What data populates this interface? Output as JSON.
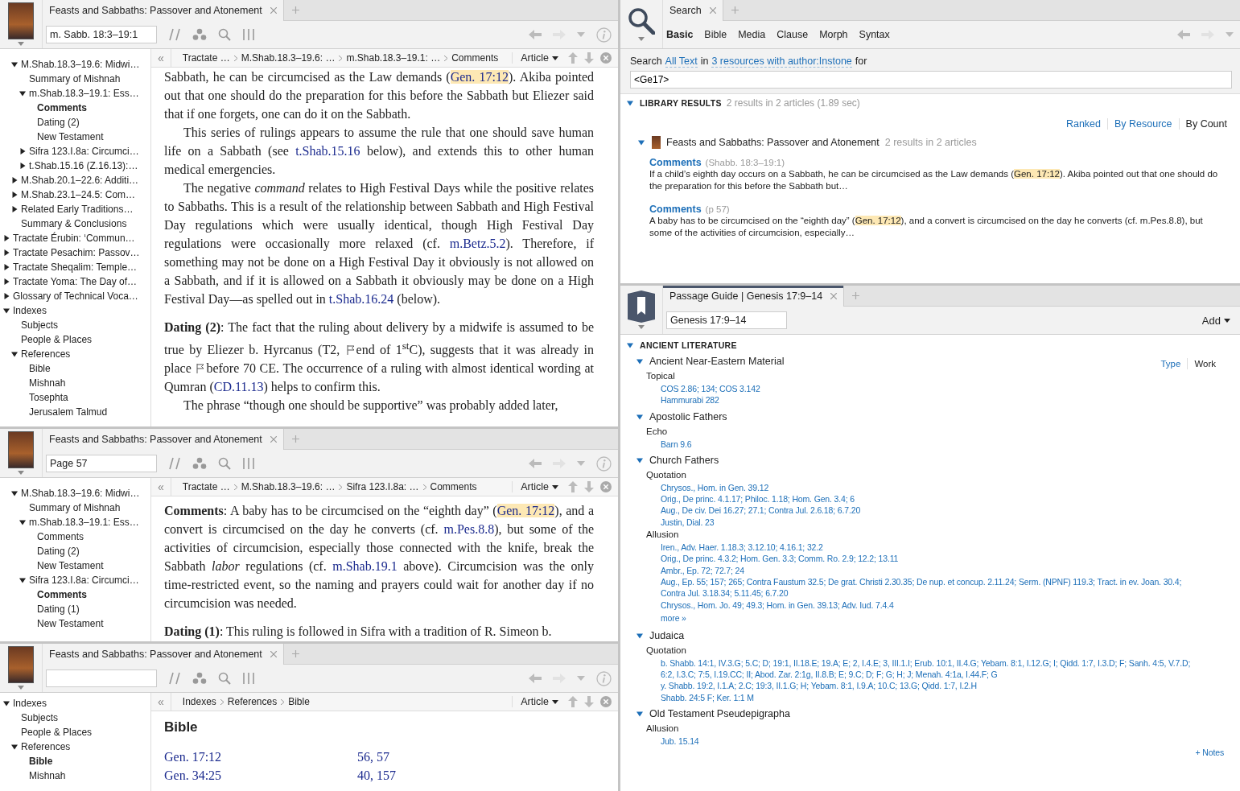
{
  "book_panels": [
    {
      "tab_title": "Feasts and Sabbaths: Passover and Atonement",
      "reference": "m. Sabb. 18:3–19:1",
      "collapse_glyph": "«",
      "view_menu": "Article",
      "tree": [
        {
          "children": [
            {
              "label": "M.Shab.18.3–19.6: Midwi…",
              "selected": false,
              "expanded": true,
              "children": [
                {
                  "label": "Summary of Mishnah",
                  "selected": false
                },
                {
                  "label": "m.Shab.18.3–19.1: Ess…",
                  "selected": false,
                  "expanded": true,
                  "children": [
                    {
                      "label": "Comments",
                      "selected": true
                    },
                    {
                      "label": "Dating (2)",
                      "selected": false
                    },
                    {
                      "label": "New Testament",
                      "selected": false
                    }
                  ]
                },
                {
                  "label": "Sifra 123.I.8a: Circumci…",
                  "selected": false,
                  "expanded": false
                },
                {
                  "label": "t.Shab.15.16 (Z.16.13):…",
                  "selected": false,
                  "expanded": false
                }
              ]
            },
            {
              "label": "M.Shab.20.1–22.6: Additi…",
              "selected": false,
              "expanded": false
            },
            {
              "label": "M.Shab.23.1–24.5: Com…",
              "selected": false,
              "expanded": false
            },
            {
              "label": "Related Early Traditions…",
              "selected": false,
              "expanded": false
            },
            {
              "label": "Summary & Conclusions",
              "selected": false
            }
          ]
        },
        {
          "label": "Tractate Érubin: ‘Commun…",
          "selected": false,
          "expanded": false
        },
        {
          "label": "Tractate Pesachim: Passov…",
          "selected": false,
          "expanded": false
        },
        {
          "label": "Tractate Sheqalim: Temple…",
          "selected": false,
          "expanded": false
        },
        {
          "label": "Tractate Yoma: The Day of…",
          "selected": false,
          "expanded": false
        },
        {
          "label": "Glossary of Technical Voca…",
          "selected": false,
          "expanded": false
        },
        {
          "label": "Indexes",
          "selected": false,
          "expanded": true,
          "children": [
            {
              "label": "Subjects",
              "selected": false
            },
            {
              "label": "People & Places",
              "selected": false
            },
            {
              "label": "References",
              "selected": false,
              "expanded": true,
              "children": [
                {
                  "label": "Bible",
                  "selected": false
                },
                {
                  "label": "Mishnah",
                  "selected": false
                },
                {
                  "label": "Tosephta",
                  "selected": false
                },
                {
                  "label": "Jerusalem Talmud",
                  "selected": false
                }
              ]
            }
          ]
        }
      ],
      "breadcrumbs": [
        "Tractate …",
        "M.Shab.18.3–19.6: …",
        "m.Shab.18.3–19.1: …",
        "Comments"
      ],
      "content": [
        {
          "kind": "continuation",
          "runs": [
            {
              "kind": "text",
              "text": "Sabbath, he can be circumcised as the Law demands ("
            },
            {
              "kind": "link",
              "text": "Gen. 17:12",
              "highlighted": true
            },
            {
              "kind": "text",
              "text": "). Akiba pointed out that one should do the preparation for this before the Sabbath but Eliezer said that if one forgets, one can do it on the Sabbath."
            }
          ]
        },
        {
          "kind": "indented",
          "runs": [
            {
              "kind": "text",
              "text": "This series of rulings appears to assume the rule that one should save human life on a Sabbath (see "
            },
            {
              "kind": "link",
              "text": "t.Shab.15.16",
              "highlighted": false
            },
            {
              "kind": "text",
              "text": " below), and extends this to other human medical emergencies."
            }
          ]
        },
        {
          "kind": "indented",
          "runs": [
            {
              "kind": "text",
              "text": "The negative *command* relates to High Festival Days while the positive relates to Sabbaths. This is a result of the relationship between Sabbath and High Festival Day regulations which were usually identical, though High Festival Day regulations were occasionally more relaxed (cf. "
            },
            {
              "kind": "link",
              "text": "m.Betz.5.2",
              "highlighted": false
            },
            {
              "kind": "text",
              "text": "). Therefore, if something may not be done on a High Festival Day it obviously is not allowed on a Sabbath, and if it is allowed on a Sabbath it obviously may be done on a High Festival Day—as spelled out in "
            },
            {
              "kind": "link",
              "text": "t.Shab.16.24",
              "highlighted": false
            },
            {
              "kind": "text",
              "text": " (below)."
            }
          ]
        },
        {
          "kind": "section",
          "runs": [
            {
              "kind": "text",
              "text": "**Dating (2)**: The fact that the ruling about delivery by a midwife is assumed to be true by Eliezer b. Hyrcanus (T2, "
            },
            {
              "kind": "flag"
            },
            {
              "kind": "text",
              "text": "end of 1$^{st}$C), suggests that it was already in place "
            },
            {
              "kind": "flag"
            },
            {
              "kind": "text",
              "text": "before 70 CE. The occurrence of a ruling with almost identical wording at Qumran ("
            },
            {
              "kind": "link",
              "text": "CD.11.13",
              "highlighted": false
            },
            {
              "kind": "text",
              "text": ") helps to confirm this."
            }
          ]
        },
        {
          "kind": "indented",
          "runs": [
            {
              "kind": "text",
              "text": "The phrase “though one should be supportive” was probably added later,"
            }
          ]
        }
      ]
    },
    {
      "tab_title": "Feasts and Sabbaths: Passover and Atonement",
      "reference": "Page 57",
      "collapse_glyph": "«",
      "view_menu": "Article",
      "tree": [
        {
          "children": [
            {
              "label": "M.Shab.18.3–19.6: Midwi…",
              "selected": false,
              "expanded": true,
              "children": [
                {
                  "label": "Summary of Mishnah",
                  "selected": false
                },
                {
                  "label": "m.Shab.18.3–19.1: Ess…",
                  "selected": false,
                  "expanded": true,
                  "children": [
                    {
                      "label": "Comments",
                      "selected": false
                    },
                    {
                      "label": "Dating (2)",
                      "selected": false
                    },
                    {
                      "label": "New Testament",
                      "selected": false
                    }
                  ]
                },
                {
                  "label": "Sifra 123.I.8a: Circumci…",
                  "selected": false,
                  "expanded": true,
                  "children": [
                    {
                      "label": "Comments",
                      "selected": true
                    },
                    {
                      "label": "Dating (1)",
                      "selected": false
                    },
                    {
                      "label": "New Testament",
                      "selected": false
                    }
                  ]
                }
              ]
            }
          ]
        }
      ],
      "breadcrumbs": [
        "Tractate …",
        "M.Shab.18.3–19.6: …",
        "Sifra 123.I.8a: …",
        "Comments"
      ],
      "content": [
        {
          "kind": "continuation",
          "runs": [
            {
              "kind": "text",
              "text": "**Comments**: A baby has to be circumcised on the “eighth day” ("
            },
            {
              "kind": "link",
              "text": "Gen. 17:12",
              "highlighted": true
            },
            {
              "kind": "text",
              "text": "), and a convert is circumcised on the day he converts (cf. "
            },
            {
              "kind": "link",
              "text": "m.Pes.8.8",
              "highlighted": false
            },
            {
              "kind": "text",
              "text": "), but some of the activities of circumcision, especially those connected with the knife, break the Sabbath *labor* regulations (cf. "
            },
            {
              "kind": "link",
              "text": "m.Shab.19.1",
              "highlighted": false
            },
            {
              "kind": "text",
              "text": " above). Circumcision was the only time-restricted event, so the naming and prayers could wait for another day if no circumcision was needed."
            }
          ]
        },
        {
          "kind": "section",
          "runs": [
            {
              "kind": "text",
              "text": "**Dating (1)**: This ruling is followed in Sifra with a tradition of R. Simeon b."
            }
          ]
        }
      ]
    },
    {
      "tab_title": "Feasts and Sabbaths: Passover and Atonement",
      "collapse_glyph": "«",
      "view_menu": "Article",
      "tree": [
        {
          "label": "Indexes",
          "selected": false,
          "expanded": true,
          "children": [
            {
              "label": "Subjects",
              "selected": false
            },
            {
              "label": "People & Places",
              "selected": false
            },
            {
              "label": "References",
              "selected": false,
              "expanded": true,
              "children": [
                {
                  "label": "Bible",
                  "selected": true
                },
                {
                  "label": "Mishnah",
                  "selected": false
                }
              ]
            }
          ]
        }
      ],
      "breadcrumbs": [
        "Indexes",
        "References",
        "Bible"
      ],
      "content": [
        {
          "kind": "heading",
          "text": "Bible"
        },
        {
          "kind": "index-row",
          "cells": [
            "Gen. 17:12",
            "56, 57"
          ]
        },
        {
          "kind": "index-row",
          "cells": [
            "Gen. 34:25",
            "40, 157"
          ]
        }
      ]
    }
  ],
  "search_panel": {
    "tab_title": "Search",
    "modes": [
      {
        "label": "Basic",
        "selected": true
      },
      {
        "label": "Bible",
        "selected": false
      },
      {
        "label": "Media",
        "selected": false
      },
      {
        "label": "Clause",
        "selected": false
      },
      {
        "label": "Morph",
        "selected": false
      },
      {
        "label": "Syntax",
        "selected": false
      }
    ],
    "query_line": {
      "prefix": "Search",
      "scope": "All Text",
      "joiner": "in",
      "resources": "3 resources with author:Instone",
      "suffix": "for"
    },
    "query": "<Ge17>",
    "results": {
      "heading": "LIBRARY RESULTS",
      "expanded": true,
      "summary": "2 results in 2 articles (1.89 sec)",
      "sort_options": [
        {
          "label": "Ranked",
          "selected": false
        },
        {
          "label": "By Resource",
          "selected": false
        },
        {
          "label": "By Count",
          "selected": true
        }
      ],
      "groups": [
        {
          "title": "Feasts and Sabbaths: Passover and Atonement",
          "summary": "2 results in 2 articles",
          "expanded": true,
          "hits": [
            {
              "title": "Comments",
              "location": "(Shabb. 18:3–19:1)",
              "runs": [
                {
                  "kind": "text",
                  "text": "If a child’s eighth day occurs on a Sabbath, he can be circumcised as the Law demands ("
                },
                {
                  "kind": "link",
                  "text": "Gen. 17:12",
                  "highlighted": true
                },
                {
                  "kind": "text",
                  "text": "). Akiba pointed out that one should do the preparation for this before the Sabbath but…"
                }
              ]
            },
            {
              "title": "Comments",
              "location": "(p 57)",
              "runs": [
                {
                  "kind": "text",
                  "text": "A baby has to be circumcised on the “eighth day” ("
                },
                {
                  "kind": "link",
                  "text": "Gen. 17:12",
                  "highlighted": true
                },
                {
                  "kind": "text",
                  "text": "), and a convert is circumcised on the day he converts (cf. m.Pes.8.8), but some of the activities of circumcision, especially…"
                }
              ]
            }
          ]
        }
      ]
    }
  },
  "passage_guide": {
    "tab_title": "Passage Guide | Genesis 17:9–14",
    "passage": "Genesis 17:9–14",
    "add_menu": "Add",
    "section": {
      "title": "ANCIENT LITERATURE",
      "expanded": true,
      "views": [
        {
          "label": "Type",
          "selected": false
        },
        {
          "label": "Work",
          "selected": true
        }
      ],
      "groups": [
        {
          "title": "Ancient Near-Eastern Material",
          "expanded": true,
          "categories": [
            {
              "title": "Topical",
              "lines": [
                "COS 2.86; 134; COS 3.142",
                "Hammurabi 282"
              ]
            }
          ]
        },
        {
          "title": "Apostolic Fathers",
          "expanded": true,
          "categories": [
            {
              "title": "Echo",
              "lines": [
                "Barn 9.6"
              ]
            }
          ]
        },
        {
          "title": "Church Fathers",
          "expanded": true,
          "categories": [
            {
              "title": "Quotation",
              "lines": [
                "Chrysos., Hom. in Gen. 39.12",
                "Orig., De princ. 4.1.17; Philoc. 1.18; Hom. Gen. 3.4; 6",
                "Aug., De civ. Dei 16.27; 27.1; Contra Jul. 2.6.18; 6.7.20",
                "Justin, Dial. 23"
              ]
            },
            {
              "title": "Allusion",
              "lines": [
                "Iren., Adv. Haer. 1.18.3; 3.12.10; 4.16.1; 32.2",
                "Orig., De princ. 4.3.2; Hom. Gen. 3.3; Comm. Ro. 2.9; 12.2; 13.11",
                "Ambr., Ep. 72; 72.7; 24",
                "Aug., Ep. 55; 157; 265; Contra Faustum 32.5; De grat. Christi 2.30.35; De nup. et concup. 2.11.24; Serm. (NPNF) 119.3; Tract. in ev. Joan. 30.4;",
                "Contra Jul. 3.18.34; 5.11.45; 6.7.20",
                "Chrysos., Hom. Jo. 49; 49.3; Hom. in Gen. 39.13; Adv. Iud. 7.4.4"
              ],
              "more_link": "more »"
            }
          ]
        },
        {
          "title": "Judaica",
          "expanded": true,
          "categories": [
            {
              "title": "Quotation",
              "lines": [
                "b. Shabb. 14:1, IV.3.G; 5.C; D; 19:1, II.18.E; 19.A; E; 2, I.4.E; 3, III.1.I; Erub. 10:1, II.4.G; Yebam. 8:1, I.12.G; I; Qidd. 1:7, I.3.D; F; Sanh. 4:5, V.7.D;",
                "6:2, I.3.C; 7:5, I.19.CC; II; Abod. Zar. 2:1g, II.8.B; E; 9.C; D; F; G; H; J; Menah. 4:1a, I.44.F; G",
                "y. Shabb. 19:2, I.1.A; 2.C; 19:3, II.1.G; H; Yebam. 8:1, I.9.A; 10.C; 13.G; Qidd. 1:7, I.2.H",
                "Shabb. 24:5 F; Ker. 1:1 M"
              ]
            }
          ]
        },
        {
          "title": "Old Testament Pseudepigrapha",
          "expanded": true,
          "categories": [
            {
              "title": "Allusion",
              "lines": [
                "Jub. 15.14"
              ]
            }
          ]
        }
      ]
    },
    "notes_link": "+ Notes"
  }
}
